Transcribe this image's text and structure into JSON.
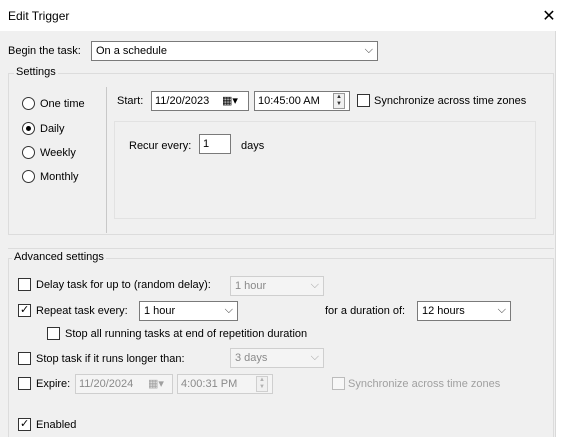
{
  "window": {
    "title": "Edit Trigger",
    "close_glyph": "✕"
  },
  "begin_task": {
    "label": "Begin the task:",
    "value": "On a schedule"
  },
  "settings": {
    "legend": "Settings",
    "radios": [
      {
        "label": "One time",
        "checked": false
      },
      {
        "label": "Daily",
        "checked": true
      },
      {
        "label": "Weekly",
        "checked": false
      },
      {
        "label": "Monthly",
        "checked": false
      }
    ],
    "start_label": "Start:",
    "start_date": "11/20/2023",
    "start_time": "10:45:00 AM",
    "sync_label": "Synchronize across time zones",
    "sync_checked": false,
    "recur_label": "Recur every:",
    "recur_value": "1",
    "recur_unit": "days"
  },
  "advanced": {
    "legend": "Advanced settings",
    "delay_label": "Delay task for up to (random delay):",
    "delay_checked": false,
    "delay_value": "1 hour",
    "repeat_label": "Repeat task every:",
    "repeat_checked": true,
    "repeat_value": "1 hour",
    "duration_label": "for a duration of:",
    "duration_value": "12 hours",
    "stop_all_label": "Stop all running tasks at end of repetition duration",
    "stop_all_checked": false,
    "stop_if_label": "Stop task if it runs longer than:",
    "stop_if_checked": false,
    "stop_if_value": "3 days",
    "expire_label": "Expire:",
    "expire_checked": false,
    "expire_date": "11/20/2024",
    "expire_time": "4:00:31 PM",
    "expire_sync_label": "Synchronize across time zones",
    "expire_sync_checked": false,
    "enabled_label": "Enabled",
    "enabled_checked": true
  },
  "icons": {
    "chevron": "chevron-down-icon",
    "calendar": "calendar-icon",
    "close": "close-icon"
  }
}
